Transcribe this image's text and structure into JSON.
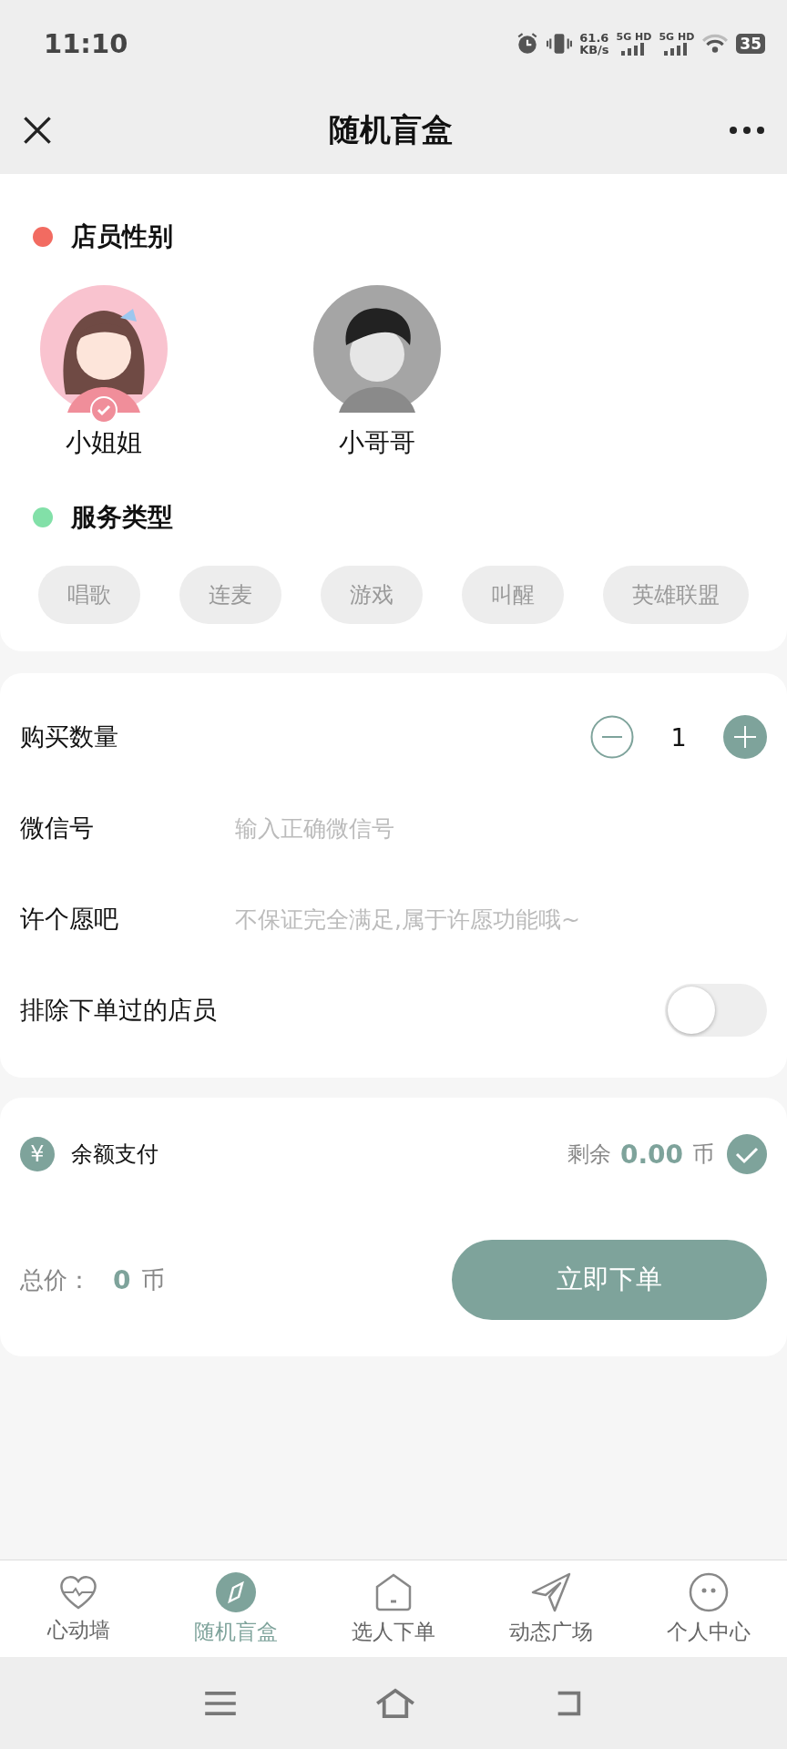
{
  "status_bar": {
    "time": "11:10",
    "network_speed": "61.6",
    "speed_unit": "KB/s",
    "sim_1": "5G HD",
    "sim_2": "5G HD",
    "battery": "35"
  },
  "header": {
    "title": "随机盲盒"
  },
  "sections": [
    {
      "title": "店员性别",
      "color": "#f26b61",
      "kind": "gender",
      "options": [
        {
          "label": "小姐姐",
          "kind": "female",
          "selected": true
        },
        {
          "label": "小哥哥",
          "kind": "male",
          "selected": false
        }
      ]
    },
    {
      "title": "服务类型",
      "color": "#82e0a8",
      "kind": "tags",
      "tags": [
        {
          "label": "唱歌",
          "selected": false
        },
        {
          "label": "连麦",
          "selected": false
        },
        {
          "label": "游戏",
          "selected": false
        },
        {
          "label": "叫醒",
          "selected": false
        },
        {
          "label": "英雄联盟",
          "selected": false
        }
      ]
    }
  ],
  "form": [
    {
      "kind": "stepper",
      "label": "购买数量",
      "value": "1"
    },
    {
      "kind": "input",
      "label": "微信号",
      "placeholder": "输入正确微信号"
    },
    {
      "kind": "input",
      "label": "许个愿吧",
      "placeholder": "不保证完全满足,属于许愿功能哦~"
    },
    {
      "kind": "toggle",
      "label": "排除下单过的店员",
      "on": false
    }
  ],
  "payment": {
    "icon": "¥",
    "label": "余额支付",
    "remaining_label": "剩余",
    "amount": "0.00",
    "unit": "币",
    "selected": true
  },
  "total": {
    "label": "总价：",
    "amount": "0",
    "unit": "币",
    "button": "立即下单"
  },
  "tab_bar": [
    {
      "label": "心动墙",
      "kind": "heart",
      "selected": false
    },
    {
      "label": "随机盲盒",
      "kind": "compass",
      "selected": true
    },
    {
      "label": "选人下单",
      "kind": "house",
      "selected": false
    },
    {
      "label": "动态广场",
      "kind": "plane",
      "selected": false
    },
    {
      "label": "个人中心",
      "kind": "smiley",
      "selected": false
    }
  ]
}
